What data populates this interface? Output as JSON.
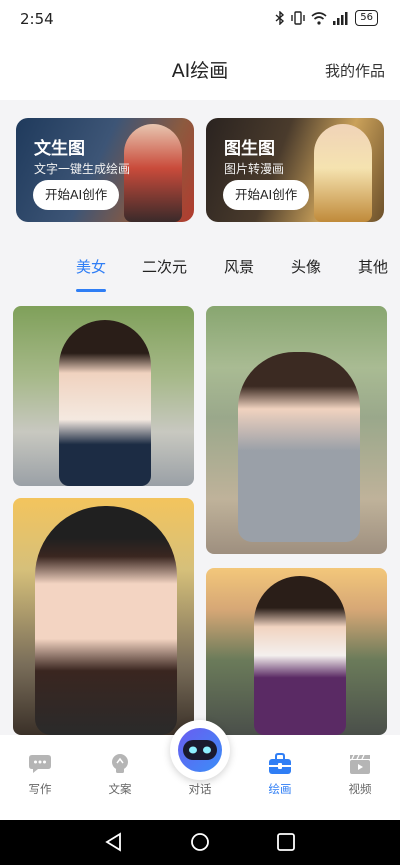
{
  "status_bar": {
    "time": "2:54",
    "battery": "56"
  },
  "header": {
    "title": "AI绘画",
    "my_works": "我的作品"
  },
  "feature_cards": [
    {
      "title": "文生图",
      "subtitle": "文字一键生成绘画",
      "button": "开始AI创作"
    },
    {
      "title": "图生图",
      "subtitle": "图片转漫画",
      "button": "开始AI创作"
    }
  ],
  "category_tabs": [
    {
      "label": "美女",
      "active": true
    },
    {
      "label": "二次元",
      "active": false
    },
    {
      "label": "风景",
      "active": false
    },
    {
      "label": "头像",
      "active": false
    },
    {
      "label": "其他",
      "active": false
    }
  ],
  "bottom_nav": [
    {
      "label": "写作",
      "icon": "chat-bubble-icon",
      "active": false
    },
    {
      "label": "文案",
      "icon": "lightbulb-icon",
      "active": false
    },
    {
      "label": "对话",
      "icon": "robot-icon",
      "active": false
    },
    {
      "label": "绘画",
      "icon": "toolbox-icon",
      "active": true
    },
    {
      "label": "视频",
      "icon": "clapperboard-icon",
      "active": false
    }
  ],
  "colors": {
    "accent": "#2f7ef5",
    "inactive_icon": "#b5b5b5",
    "background": "#f4f4f6"
  },
  "system_nav": [
    "back-icon",
    "home-icon",
    "recents-icon"
  ]
}
